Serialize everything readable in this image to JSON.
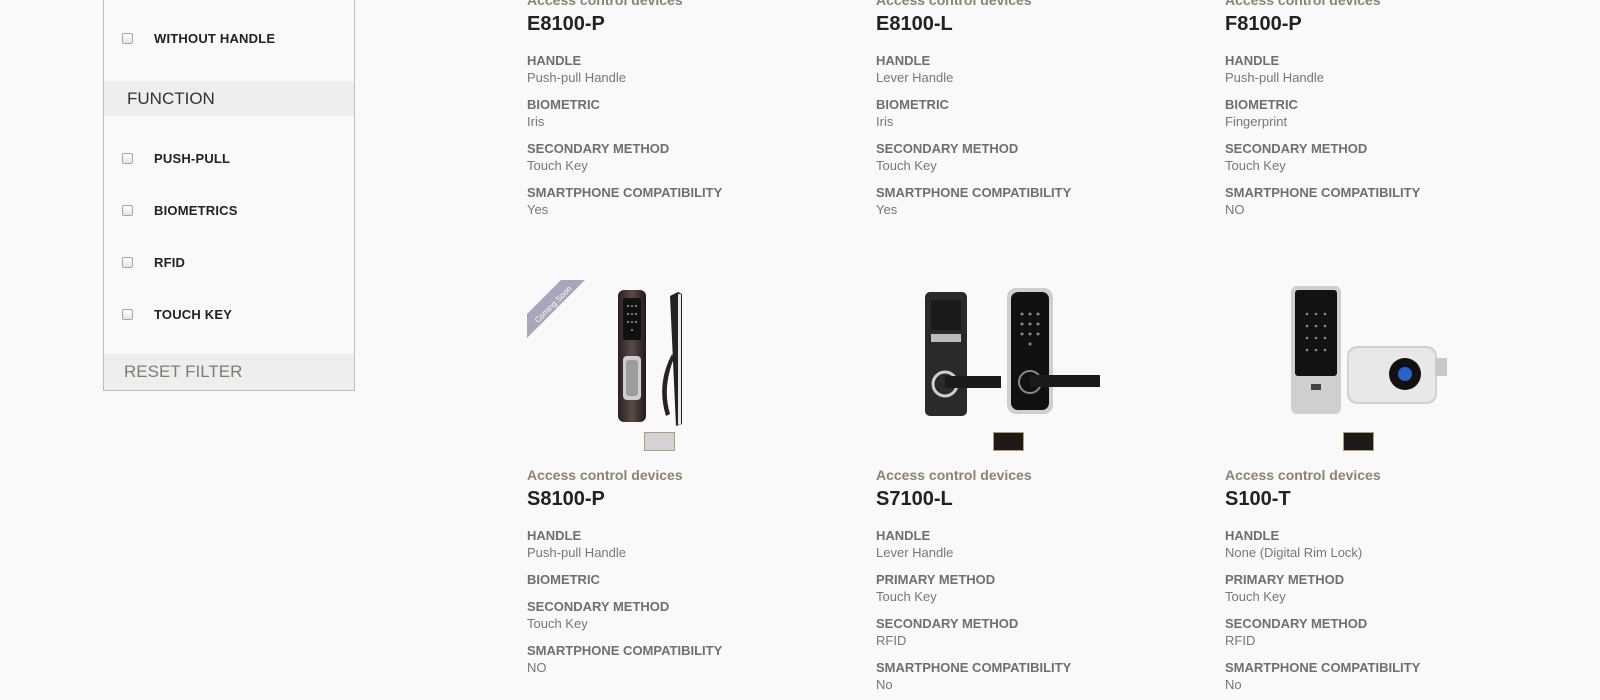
{
  "sidebar": {
    "without_handle": "WITHOUT HANDLE",
    "function_heading": "FUNCTION",
    "options": [
      "PUSH-PULL",
      "BIOMETRICS",
      "RFID",
      "TOUCH KEY"
    ],
    "reset": "RESET FILTER"
  },
  "products": [
    {
      "category": "Access control devices",
      "model": "E8100-P",
      "specs": [
        {
          "label": "HANDLE",
          "value": "Push-pull Handle"
        },
        {
          "label": "BIOMETRIC",
          "value": "Iris"
        },
        {
          "label": "SECONDARY METHOD",
          "value": "Touch Key"
        },
        {
          "label": "SMARTPHONE COMPATIBILITY",
          "value": "Yes"
        }
      ]
    },
    {
      "category": "Access control devices",
      "model": "E8100-L",
      "specs": [
        {
          "label": "HANDLE",
          "value": "Lever Handle"
        },
        {
          "label": "BIOMETRIC",
          "value": "Iris"
        },
        {
          "label": "SECONDARY METHOD",
          "value": "Touch Key"
        },
        {
          "label": "SMARTPHONE COMPATIBILITY",
          "value": "Yes"
        }
      ]
    },
    {
      "category": "Access control devices",
      "model": "F8100-P",
      "specs": [
        {
          "label": "HANDLE",
          "value": "Push-pull Handle"
        },
        {
          "label": "BIOMETRIC",
          "value": "Fingerprint"
        },
        {
          "label": "SECONDARY METHOD",
          "value": "Touch Key"
        },
        {
          "label": "SMARTPHONE COMPATIBILITY",
          "value": "NO"
        }
      ]
    },
    {
      "category": "Access control devices",
      "model": "S8100-P",
      "ribbon": "Coming Soon",
      "swatch_color": "#d3d3d6",
      "specs": [
        {
          "label": "HANDLE",
          "value": "Push-pull Handle"
        },
        {
          "label": "BIOMETRIC",
          "value": ""
        },
        {
          "label": "SECONDARY METHOD",
          "value": "Touch Key"
        },
        {
          "label": "SMARTPHONE COMPATIBILITY",
          "value": "NO"
        }
      ]
    },
    {
      "category": "Access control devices",
      "model": "S7100-L",
      "swatch_color": "#1e1a17",
      "specs": [
        {
          "label": "HANDLE",
          "value": "Lever Handle"
        },
        {
          "label": "PRIMARY METHOD",
          "value": "Touch Key"
        },
        {
          "label": "SECONDARY METHOD",
          "value": "RFID"
        },
        {
          "label": "SMARTPHONE COMPATIBILITY",
          "value": "No"
        }
      ]
    },
    {
      "category": "Access control devices",
      "model": "S100-T",
      "swatch_color": "#1e1a17",
      "specs": [
        {
          "label": "HANDLE",
          "value": "None (Digital Rim Lock)"
        },
        {
          "label": "PRIMARY METHOD",
          "value": "Touch Key"
        },
        {
          "label": "SECONDARY METHOD",
          "value": "RFID"
        },
        {
          "label": "SMARTPHONE COMPATIBILITY",
          "value": "No"
        }
      ]
    }
  ],
  "colors": {
    "category": "#8e8270",
    "ribbon": "#a7a6bb",
    "swatch_border": "#b59c74"
  }
}
